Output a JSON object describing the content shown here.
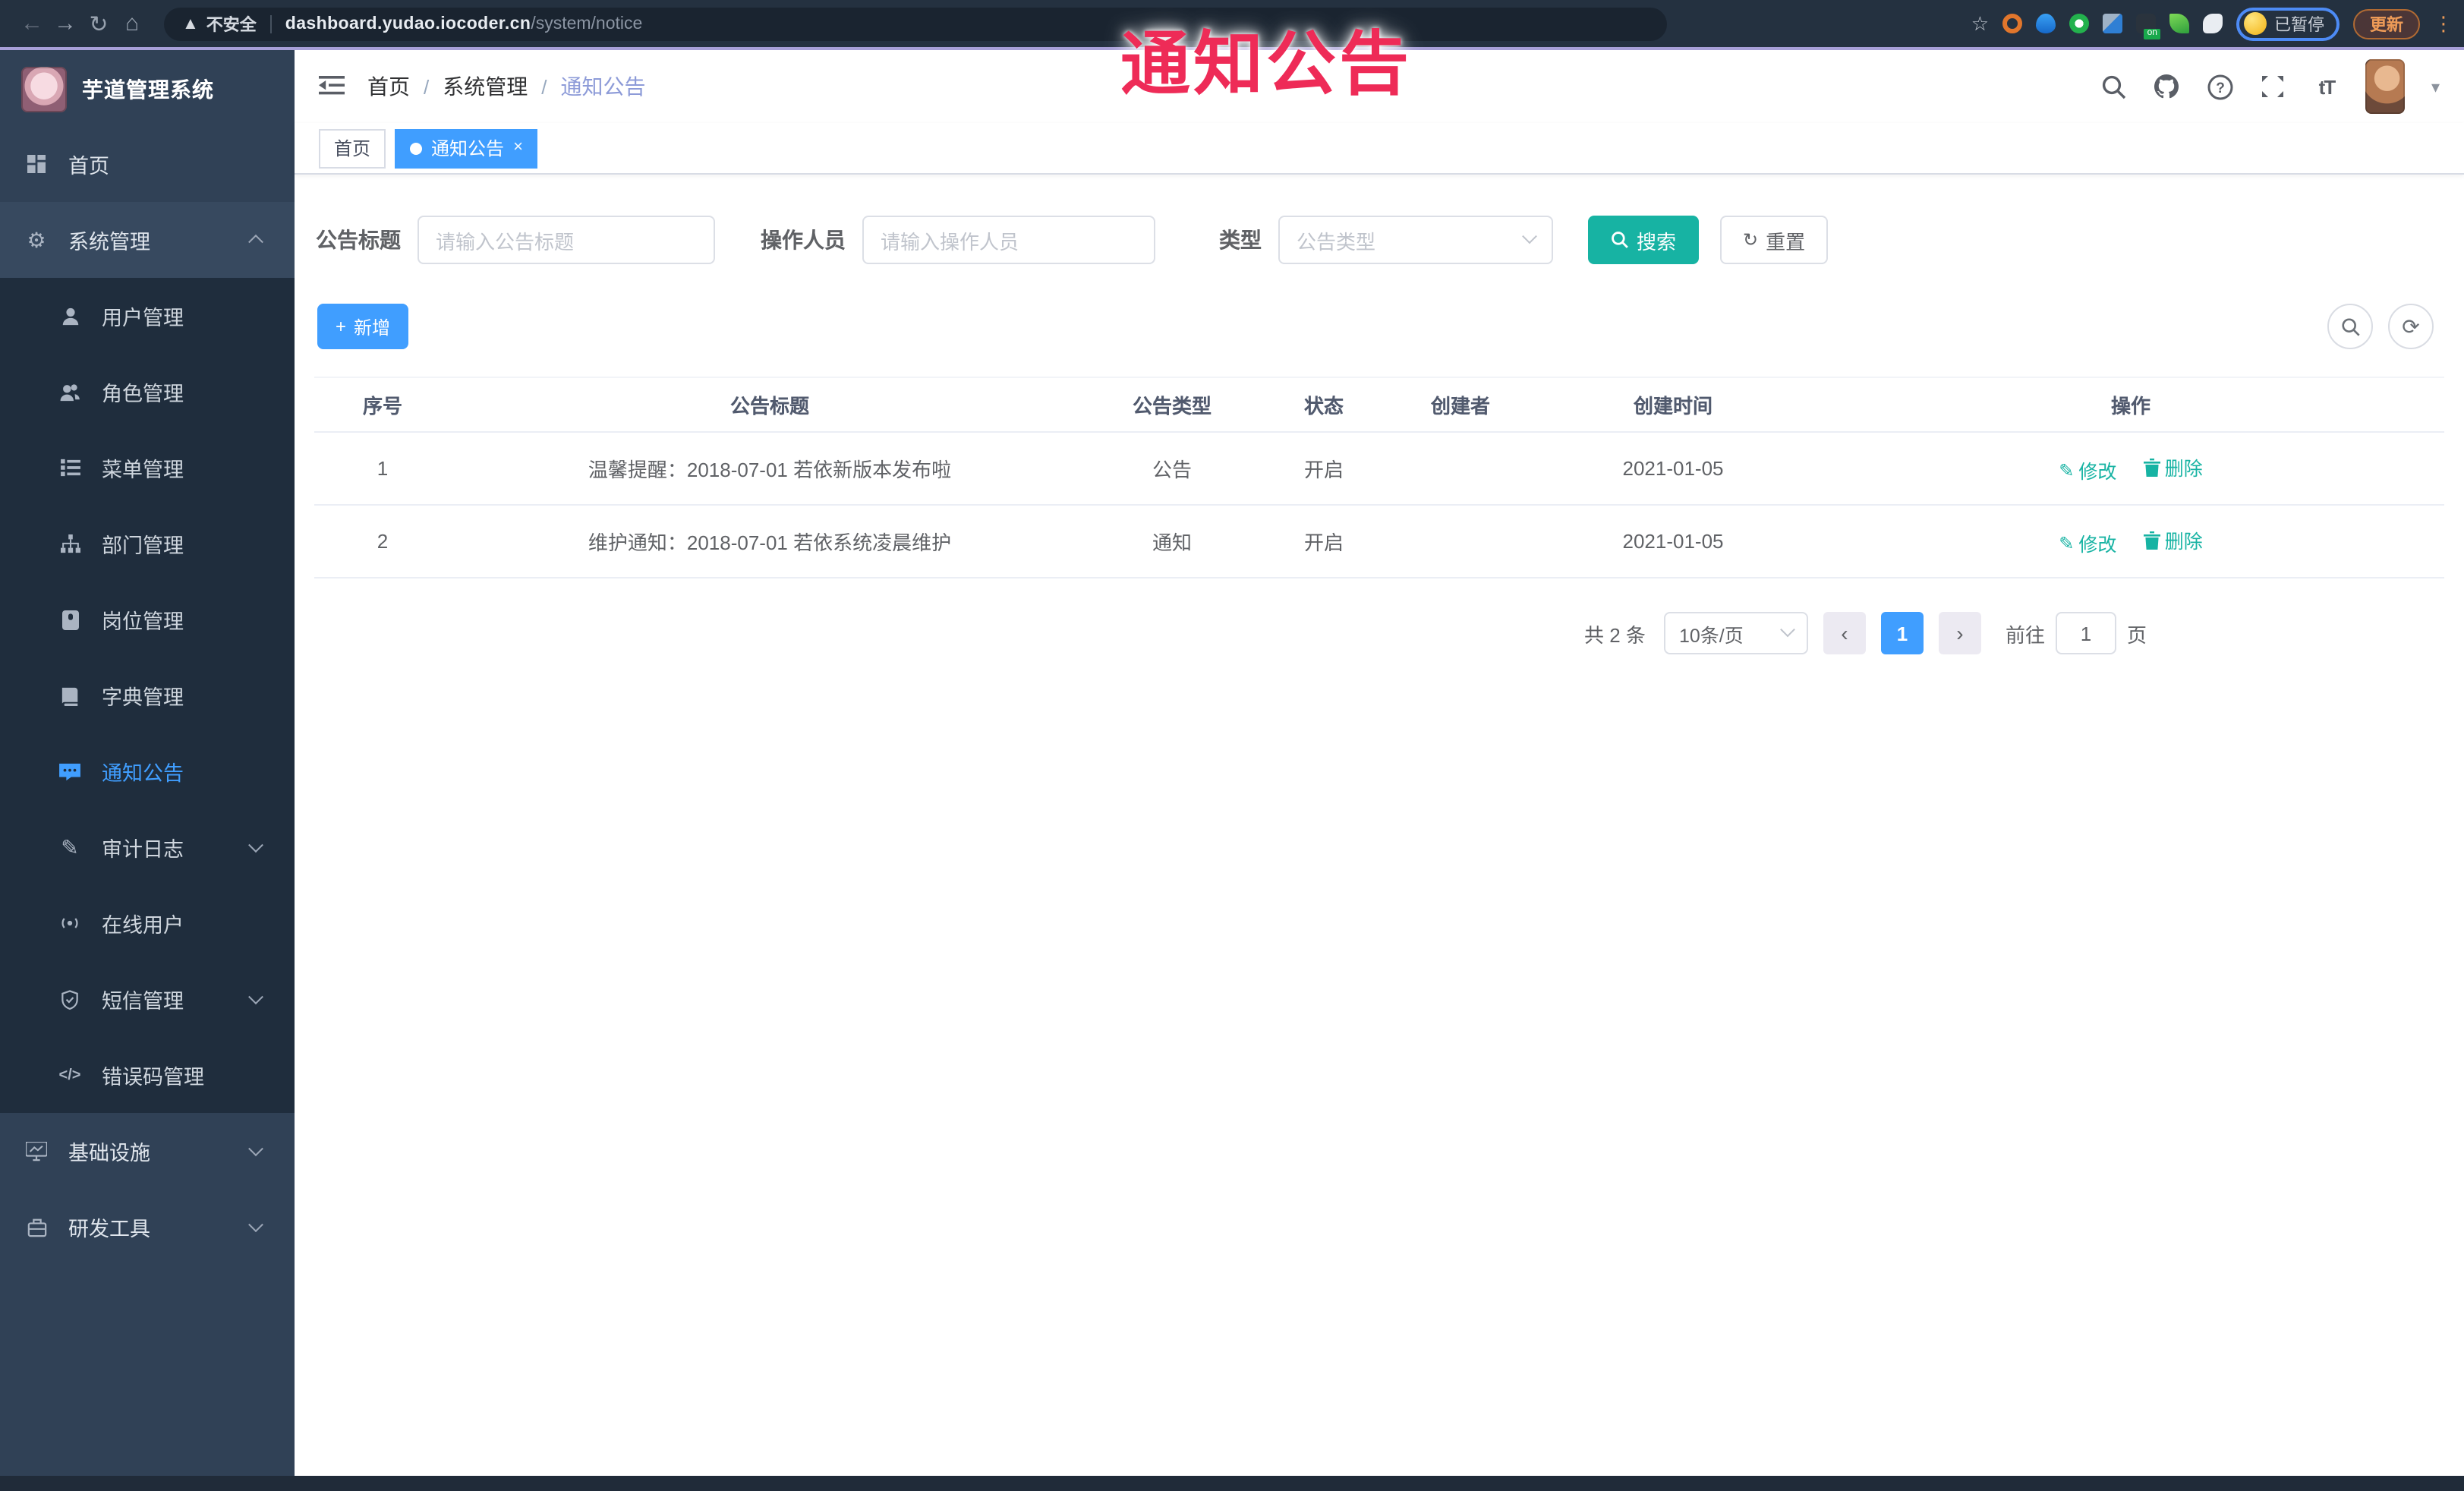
{
  "browser": {
    "security_label": "不安全",
    "url_domain": "dashboard.yudao.iocoder.cn",
    "url_path": "/system/notice",
    "paused_chip": "已暂停",
    "update_button": "更新",
    "extension_on_badge": "on"
  },
  "annotation": {
    "text": "通知公告",
    "color": "#ee2b57"
  },
  "sidebar": {
    "title": "芋道管理系统",
    "items": [
      {
        "label": "首页",
        "level": "top",
        "icon": "dashboard-icon"
      },
      {
        "label": "系统管理",
        "level": "top",
        "icon": "gear-icon",
        "expanded": true
      },
      {
        "label": "用户管理",
        "level": "sub",
        "icon": "user-icon"
      },
      {
        "label": "角色管理",
        "level": "sub",
        "icon": "users-icon"
      },
      {
        "label": "菜单管理",
        "level": "sub",
        "icon": "menu-list-icon"
      },
      {
        "label": "部门管理",
        "level": "sub",
        "icon": "org-tree-icon"
      },
      {
        "label": "岗位管理",
        "level": "sub",
        "icon": "badge-icon"
      },
      {
        "label": "字典管理",
        "level": "sub",
        "icon": "dictionary-icon"
      },
      {
        "label": "通知公告",
        "level": "sub",
        "icon": "notice-icon",
        "active": true
      },
      {
        "label": "审计日志",
        "level": "sub",
        "icon": "audit-log-icon",
        "expandable": true
      },
      {
        "label": "在线用户",
        "level": "sub",
        "icon": "online-user-icon"
      },
      {
        "label": "短信管理",
        "level": "sub",
        "icon": "sms-icon",
        "expandable": true
      },
      {
        "label": "错误码管理",
        "level": "sub",
        "icon": "error-code-icon"
      },
      {
        "label": "基础设施",
        "level": "top",
        "icon": "infrastructure-icon",
        "expandable": true
      },
      {
        "label": "研发工具",
        "level": "top",
        "icon": "dev-tools-icon",
        "expandable": true
      }
    ]
  },
  "header": {
    "breadcrumbs": [
      "首页",
      "系统管理",
      "通知公告"
    ]
  },
  "tabs": [
    {
      "label": "首页",
      "active": false
    },
    {
      "label": "通知公告",
      "active": true
    }
  ],
  "filter": {
    "title_label": "公告标题",
    "title_placeholder": "请输入公告标题",
    "operator_label": "操作人员",
    "operator_placeholder": "请输入操作人员",
    "type_label": "类型",
    "type_placeholder": "公告类型",
    "search_label": "搜索",
    "reset_label": "重置"
  },
  "toolbar": {
    "add_label": "新增"
  },
  "table": {
    "headers": [
      "序号",
      "公告标题",
      "公告类型",
      "状态",
      "创建者",
      "创建时间",
      "操作"
    ],
    "rows": [
      {
        "no": "1",
        "title": "温馨提醒：2018-07-01 若依新版本发布啦",
        "type": "公告",
        "status": "开启",
        "creator": "",
        "created": "2021-01-05"
      },
      {
        "no": "2",
        "title": "维护通知：2018-07-01 若依系统凌晨维护",
        "type": "通知",
        "status": "开启",
        "creator": "",
        "created": "2021-01-05"
      }
    ],
    "edit_label": "修改",
    "delete_label": "删除"
  },
  "pagination": {
    "total": "共 2 条",
    "page_size": "10条/页",
    "current_page": "1",
    "goto_label": "前往",
    "goto_value": "1",
    "page_unit": "页"
  },
  "colors": {
    "accent": "#409eff",
    "teal": "#17b3a3",
    "annotation": "#ee2b57",
    "sidebar_bg": "#304156",
    "submenu_bg": "#1f2d3d",
    "chrome_bg": "#243140"
  }
}
